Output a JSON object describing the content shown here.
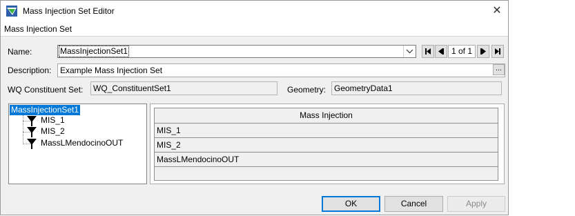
{
  "window": {
    "title": "Mass Injection Set Editor",
    "close_glyph": "✕"
  },
  "menu": {
    "label": "Mass Injection Set"
  },
  "form": {
    "name_label": "Name:",
    "name_value": "MassInjectionSet1",
    "page_indicator": "1 of 1",
    "description_label": "Description:",
    "description_value": "Example Mass Injection Set",
    "ellipsis": "...",
    "wq_label": "WQ Constituent Set:",
    "wq_value": "WQ_ConstituentSet1",
    "geometry_label": "Geometry:",
    "geometry_value": "GeometryData1"
  },
  "tree": {
    "root": "MassInjectionSet1",
    "children": [
      "MIS_1",
      "MIS_2",
      "MassLMendocinoOUT"
    ]
  },
  "table": {
    "header": "Mass Injection",
    "rows": [
      "MIS_1",
      "MIS_2",
      "MassLMendocinoOUT"
    ]
  },
  "buttons": {
    "ok": "OK",
    "cancel": "Cancel",
    "apply": "Apply"
  },
  "icons": {
    "app": "app-icon",
    "first": "first-record-icon",
    "prev": "previous-record-icon",
    "next": "next-record-icon",
    "last": "last-record-icon",
    "injection": "mass-injection-icon"
  },
  "colors": {
    "selection": "#0078d7",
    "default_button_border": "#0078d7"
  }
}
